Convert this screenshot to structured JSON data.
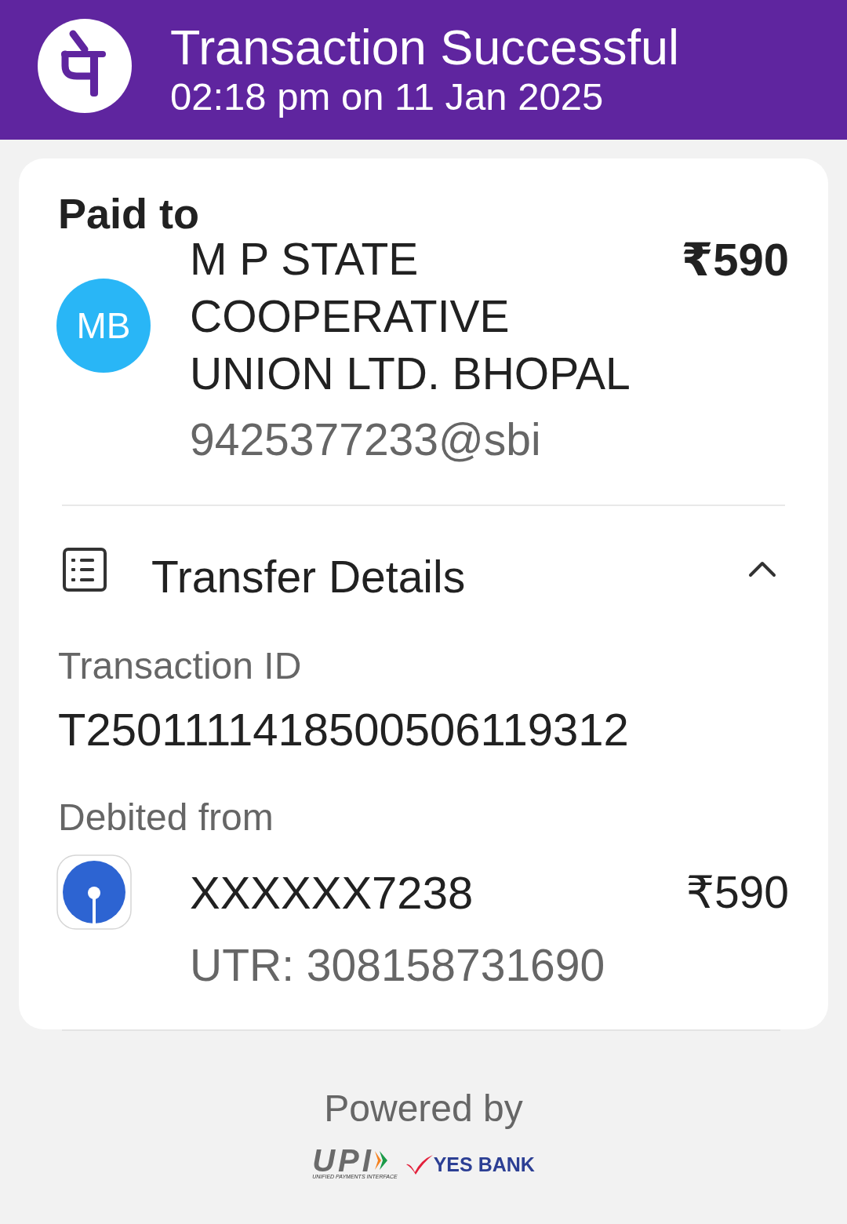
{
  "header": {
    "title": "Transaction Successful",
    "timestamp": "02:18 pm on 11 Jan 2025"
  },
  "paid_to": {
    "label": "Paid to",
    "avatar_initials": "MB",
    "name": "M P STATE COOPERATIVE UNION LTD. BHOPAL",
    "amount": "₹590",
    "upi_id": "9425377233@sbi"
  },
  "transfer_details": {
    "title": "Transfer Details",
    "expanded": true,
    "transaction_id": {
      "label": "Transaction ID",
      "value": "T2501111418500506119312"
    },
    "debited_from": {
      "label": "Debited from",
      "account": "XXXXXX7238",
      "amount": "₹590",
      "utr": "UTR: 308158731690"
    }
  },
  "footer": {
    "powered_by": "Powered by",
    "upi_wordmark": "UPI",
    "upi_tagline": "UNIFIED PAYMENTS INTERFACE",
    "bank_wordmark": "YES BANK"
  }
}
